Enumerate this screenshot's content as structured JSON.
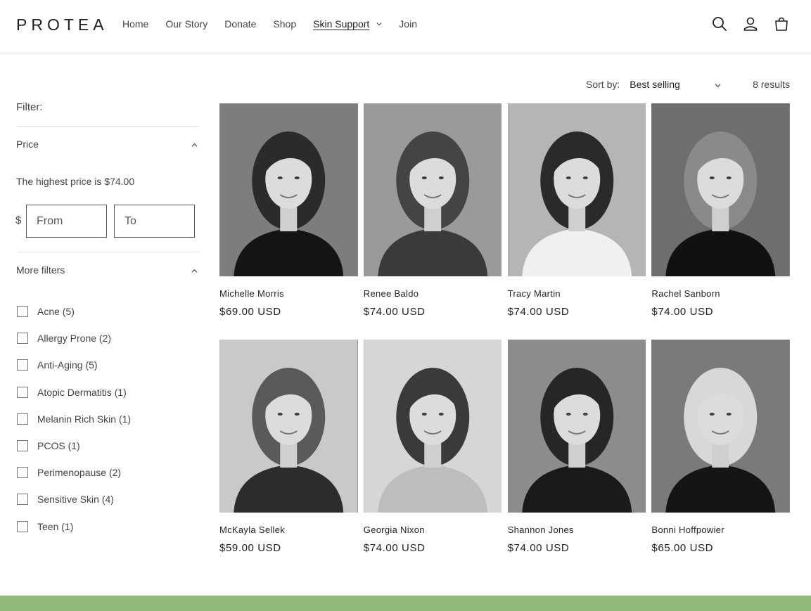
{
  "brand": {
    "logo": "PROTEA",
    "accent": "#92b87a"
  },
  "nav": {
    "items": [
      {
        "label": "Home"
      },
      {
        "label": "Our Story"
      },
      {
        "label": "Donate"
      },
      {
        "label": "Shop"
      },
      {
        "label": "Skin Support",
        "active": true
      },
      {
        "label": "Join"
      }
    ]
  },
  "header_icons": [
    "search-icon",
    "account-icon",
    "cart-icon"
  ],
  "sort": {
    "label": "Sort by:",
    "value": "Best selling",
    "results": "8 results"
  },
  "filter": {
    "title": "Filter:",
    "price": {
      "label": "Price",
      "note": "The highest price is $74.00",
      "currency": "$",
      "from_placeholder": "From",
      "to_placeholder": "To"
    },
    "more": {
      "label": "More filters",
      "options": [
        {
          "label": "Acne (5)"
        },
        {
          "label": "Allergy Prone (2)"
        },
        {
          "label": "Anti-Aging (5)"
        },
        {
          "label": "Atopic Dermatitis (1)"
        },
        {
          "label": "Melanin Rich Skin (1)"
        },
        {
          "label": "PCOS (1)"
        },
        {
          "label": "Perimenopause (2)"
        },
        {
          "label": "Sensitive Skin (4)"
        },
        {
          "label": "Teen (1)"
        }
      ]
    }
  },
  "products": [
    {
      "name": "Michelle Morris",
      "price": "$69.00 USD",
      "bg": "#7d7d7d",
      "shirt": "#141414",
      "hair": "#2b2b2b"
    },
    {
      "name": "Renee Baldo",
      "price": "$74.00 USD",
      "bg": "#9a9a9a",
      "shirt": "#3a3a3a",
      "hair": "#444444"
    },
    {
      "name": "Tracy Martin",
      "price": "$74.00 USD",
      "bg": "#b5b5b5",
      "shirt": "#f0f0f0",
      "hair": "#2a2a2a"
    },
    {
      "name": "Rachel Sanborn",
      "price": "$74.00 USD",
      "bg": "#6e6e6e",
      "shirt": "#111111",
      "hair": "#8a8a8a"
    },
    {
      "name": "McKayla Sellek",
      "price": "$59.00 USD",
      "bg": "#c9c9c9",
      "shirt": "#2c2c2c",
      "hair": "#5a5a5a"
    },
    {
      "name": "Georgia Nixon",
      "price": "$74.00 USD",
      "bg": "#d6d6d6",
      "shirt": "#bdbdbd",
      "hair": "#3a3a3a"
    },
    {
      "name": "Shannon Jones",
      "price": "$74.00 USD",
      "bg": "#8c8c8c",
      "shirt": "#1a1a1a",
      "hair": "#262626"
    },
    {
      "name": "Bonni Hoffpowier",
      "price": "$65.00 USD",
      "bg": "#7a7a7a",
      "shirt": "#151515",
      "hair": "#d8d8d8"
    }
  ]
}
